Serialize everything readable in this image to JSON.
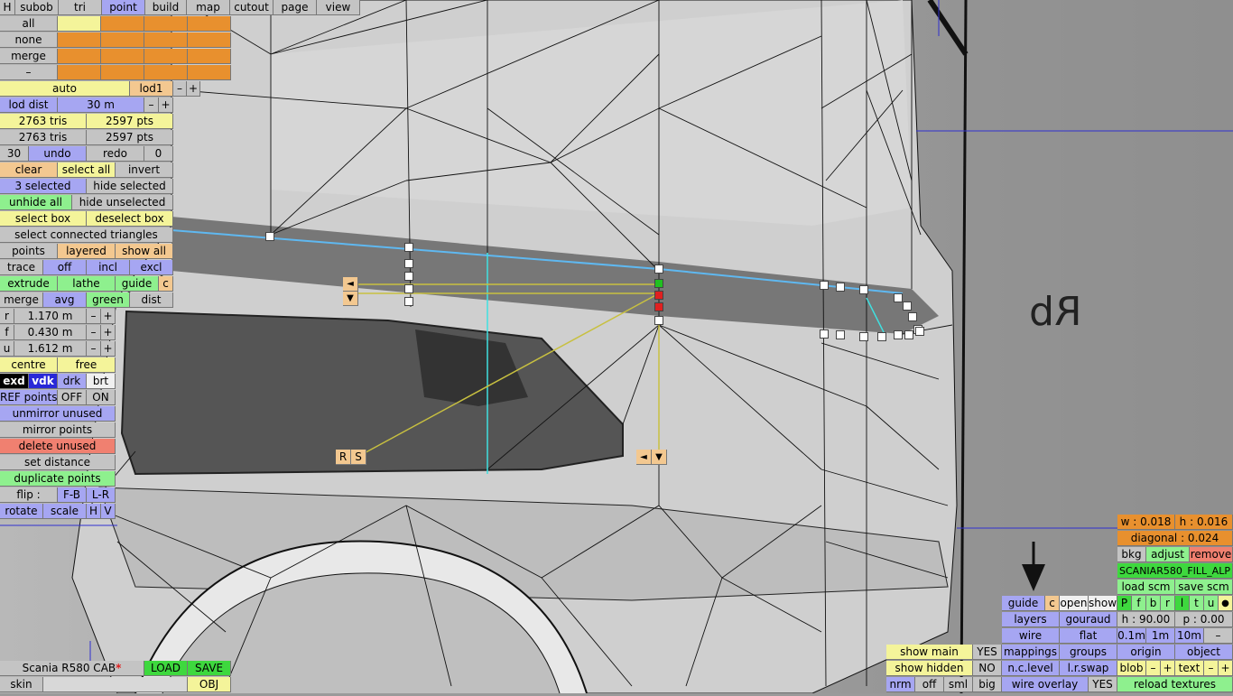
{
  "toolbar": {
    "h": "H",
    "subob": "subob",
    "tri": "tri",
    "point": "point",
    "build": "build",
    "map": "map",
    "cutout": "cutout",
    "page": "page",
    "view": "view"
  },
  "select_modes": {
    "all": "all",
    "none": "none",
    "merge": "merge",
    "minus": "–"
  },
  "lod": {
    "auto": "auto",
    "lod1": "lod1",
    "minus": "–",
    "plus": "+",
    "dist_label": "lod dist",
    "dist_value": "30 m",
    "dist_minus": "–",
    "dist_plus": "+"
  },
  "stats": {
    "tris1": "2763 tris",
    "pts1": "2597 pts",
    "tris2": "2763 tris",
    "pts2": "2597 pts"
  },
  "history": {
    "undo_count": "30",
    "undo": "undo",
    "redo": "redo",
    "redo_count": "0"
  },
  "selection": {
    "clear": "clear",
    "select_all": "select all",
    "invert": "invert",
    "selected": "3 selected",
    "hide_selected": "hide selected",
    "unhide_all": "unhide all",
    "hide_unselected": "hide unselected",
    "select_box": "select box",
    "deselect_box": "deselect box",
    "select_connected": "select connected triangles"
  },
  "points_row": {
    "points": "points",
    "layered": "layered",
    "show_all": "show all"
  },
  "trace_row": {
    "trace": "trace",
    "off": "off",
    "incl": "incl",
    "excl": "excl"
  },
  "extrude_row": {
    "extrude": "extrude",
    "lathe": "lathe",
    "guide": "guide",
    "c": "c"
  },
  "merge_row": {
    "merge": "merge",
    "avg": "avg",
    "green": "green",
    "dist": "dist"
  },
  "params": [
    {
      "key": "r",
      "value": "1.170 m"
    },
    {
      "key": "f",
      "value": "0.430 m"
    },
    {
      "key": "u",
      "value": "1.612 m"
    }
  ],
  "pm": {
    "minus": "–",
    "plus": "+"
  },
  "centre_row": {
    "centre": "centre",
    "free": "free"
  },
  "display_row": {
    "exd": "exd",
    "vdk": "vdk",
    "drk": "drk",
    "brt": "brt"
  },
  "ref_row": {
    "ref": "REF points",
    "off": "OFF",
    "on": "ON"
  },
  "actions": {
    "unmirror": "unmirror unused",
    "mirror": "mirror points",
    "delete": "delete unused",
    "set_distance": "set distance",
    "duplicate": "duplicate points"
  },
  "flip_row": {
    "flip": "flip :",
    "fb": "F-B",
    "lr": "L-R"
  },
  "transform_row": {
    "rotate": "rotate",
    "scale": "scale",
    "h": "H",
    "v": "V"
  },
  "file": {
    "name": "Scania R580 CAB",
    "modified": "*",
    "load": "LOAD",
    "save": "SAVE",
    "skin": "skin",
    "obj": "OBJ"
  },
  "bottom_mid": {
    "show_main": "show main",
    "show_main_val": "YES",
    "show_hidden": "show hidden",
    "show_hidden_val": "NO",
    "nrm": "nrm",
    "off": "off",
    "sml": "sml",
    "big": "big"
  },
  "right_panel": {
    "w": "w : 0.018",
    "h": "h : 0.016",
    "diagonal": "diagonal : 0.024",
    "bkg": "bkg",
    "adjust": "adjust",
    "remove": "remove",
    "texture": "SCANIAR580_FILL_ALP",
    "load_scm": "load scm",
    "save_scm": "save scm",
    "guide": "guide",
    "c": "c",
    "open": "open",
    "show": "show",
    "pfbrltu": [
      "P",
      "f",
      "b",
      "r",
      "l",
      "t",
      "u"
    ],
    "dot": "●",
    "layers": "layers",
    "gouraud": "gouraud",
    "h_val": "h : 90.00",
    "p_val": "p : 0.00",
    "wire": "wire",
    "flat": "flat",
    "s01": "0.1m",
    "s1": "1m",
    "s10": "10m",
    "sminus": "–",
    "mappings": "mappings",
    "groups": "groups",
    "origin": "origin",
    "object": "object",
    "nc_level": "n.c.level",
    "lr_swap": "l.r.swap",
    "blob": "blob",
    "blob_minus": "–",
    "blob_plus": "+",
    "text": "text",
    "text_minus": "–",
    "text_plus": "+",
    "wire_overlay": "wire overlay",
    "wire_overlay_val": "YES",
    "reload": "reload textures"
  },
  "viewport": {
    "rb_label": "Rb",
    "arrow_left": "◄",
    "arrow_down": "▼",
    "r_btn": "R",
    "s_btn": "S"
  },
  "colors": {
    "accent_blue": "#2828d8",
    "selection_green": "#20c020",
    "selection_red": "#e02020",
    "guide_yellow": "#c8c040",
    "ref_cyan": "#40e0e0"
  }
}
